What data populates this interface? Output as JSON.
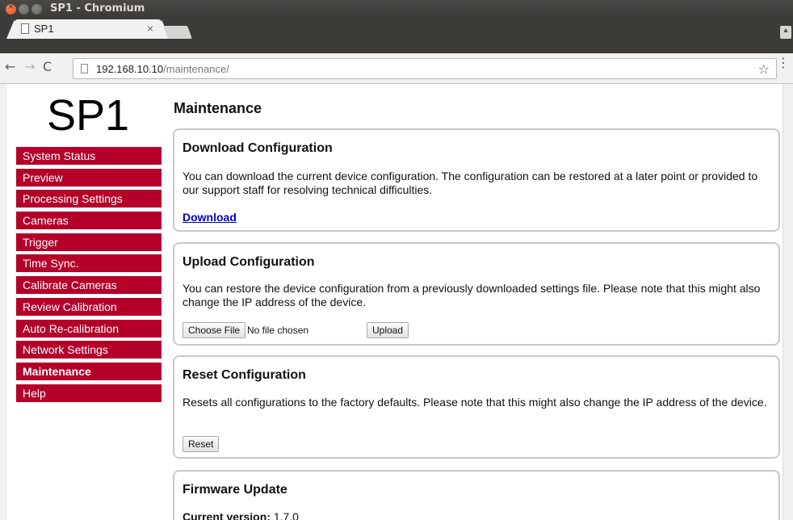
{
  "window": {
    "title": "SP1 - Chromium"
  },
  "tabs": [
    {
      "title": "SP1"
    }
  ],
  "toolbar": {
    "url_host": "192.168.10.10",
    "url_path": "/maintenance/"
  },
  "page": {
    "logo": "SP1",
    "heading": "Maintenance",
    "sidebar": [
      {
        "label": "System Status"
      },
      {
        "label": "Preview"
      },
      {
        "label": "Processing Settings"
      },
      {
        "label": "Cameras"
      },
      {
        "label": "Trigger"
      },
      {
        "label": "Time Sync."
      },
      {
        "label": "Calibrate Cameras"
      },
      {
        "label": "Review Calibration"
      },
      {
        "label": "Auto Re-calibration"
      },
      {
        "label": "Network Settings"
      },
      {
        "label": "Maintenance",
        "active": true
      },
      {
        "label": "Help"
      }
    ],
    "download": {
      "title": "Download Configuration",
      "text": "You can download the current device configuration. The configuration can be restored at a later point or provided to our support staff for resolving technical difficulties.",
      "link": "Download"
    },
    "upload": {
      "title": "Upload Configuration",
      "text": "You can restore the device configuration from a previously downloaded settings file. Please note that this might also change the IP address of the device.",
      "choose_file": "Choose File",
      "no_file": "No file chosen",
      "upload_button": "Upload"
    },
    "reset": {
      "title": "Reset Configuration",
      "text": "Resets all configurations to the factory defaults. Please note that this might also change the IP address of the device.",
      "reset_button": "Reset"
    },
    "firmware": {
      "title": "Firmware Update",
      "version_label": "Current version:",
      "version": "1.7.0"
    }
  }
}
